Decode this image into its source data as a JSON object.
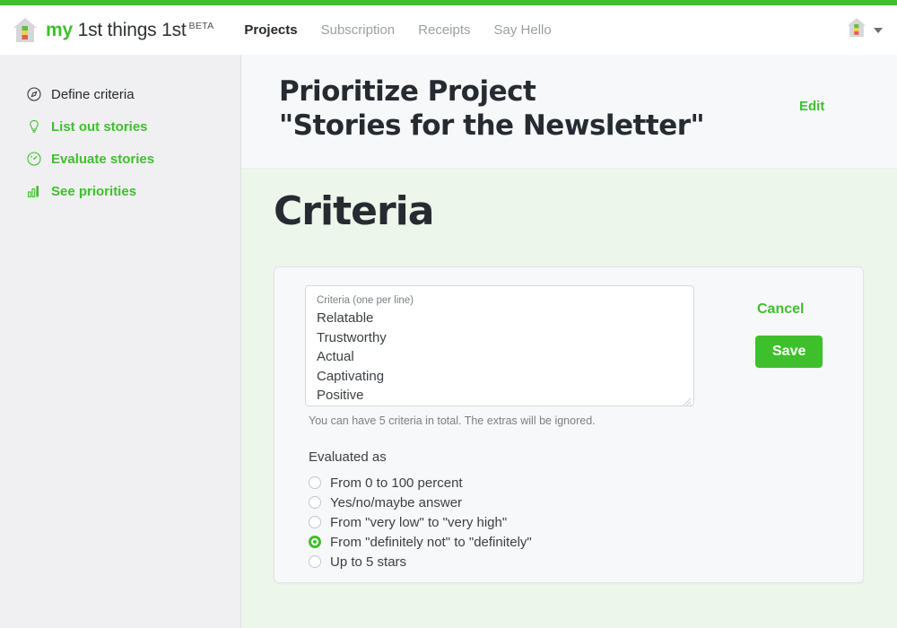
{
  "theme": {
    "brand_green": "#3ec02c",
    "page_green_bg": "#ecf6ea",
    "sidebar_bg": "#f0f0f2",
    "card_bg": "#f7f8fa",
    "header_bg": "#f7f8fa",
    "text_dark": "#252b30",
    "text_muted": "#7b8085"
  },
  "navbar": {
    "logo_icon": "house-logo-icon",
    "brand_my": "my",
    "brand_rest": " 1st things 1st",
    "beta_tag": "BETA",
    "links": [
      {
        "label": "Projects",
        "active": true
      },
      {
        "label": "Subscription",
        "active": false
      },
      {
        "label": "Receipts",
        "active": false
      },
      {
        "label": "Say Hello",
        "active": false
      }
    ],
    "avatar_icon": "house-avatar-icon",
    "caret_icon": "chevron-down-icon"
  },
  "sidebar": {
    "items": [
      {
        "label": "Define criteria",
        "icon": "compass-icon",
        "current": true
      },
      {
        "label": "List out stories",
        "icon": "lightbulb-icon",
        "current": false
      },
      {
        "label": "Evaluate stories",
        "icon": "gauge-icon",
        "current": false
      },
      {
        "label": "See priorities",
        "icon": "bar-chart-icon",
        "current": false
      }
    ]
  },
  "header": {
    "title_line1": "Prioritize Project",
    "title_line2": "\"Stories for the Newsletter\"",
    "edit_label": "Edit"
  },
  "main": {
    "section_title": "Criteria",
    "criteria_textarea": {
      "label": "Criteria (one per line)",
      "value": "Relatable\nTrustworthy\nActual\nCaptivating\nPositive",
      "lines": [
        "Relatable",
        "Trustworthy",
        "Actual",
        "Captivating",
        "Positive"
      ]
    },
    "help_text": "You can have 5 criteria in total. The extras will be ignored.",
    "evaluated_as_label": "Evaluated as",
    "evaluation_options": [
      {
        "label": "From 0 to 100 percent",
        "selected": false
      },
      {
        "label": "Yes/no/maybe answer",
        "selected": false
      },
      {
        "label": "From \"very low\" to \"very high\"",
        "selected": false
      },
      {
        "label": "From \"definitely not\" to \"definitely\"",
        "selected": true
      },
      {
        "label": "Up to 5 stars",
        "selected": false
      }
    ],
    "cancel_label": "Cancel",
    "save_label": "Save"
  }
}
